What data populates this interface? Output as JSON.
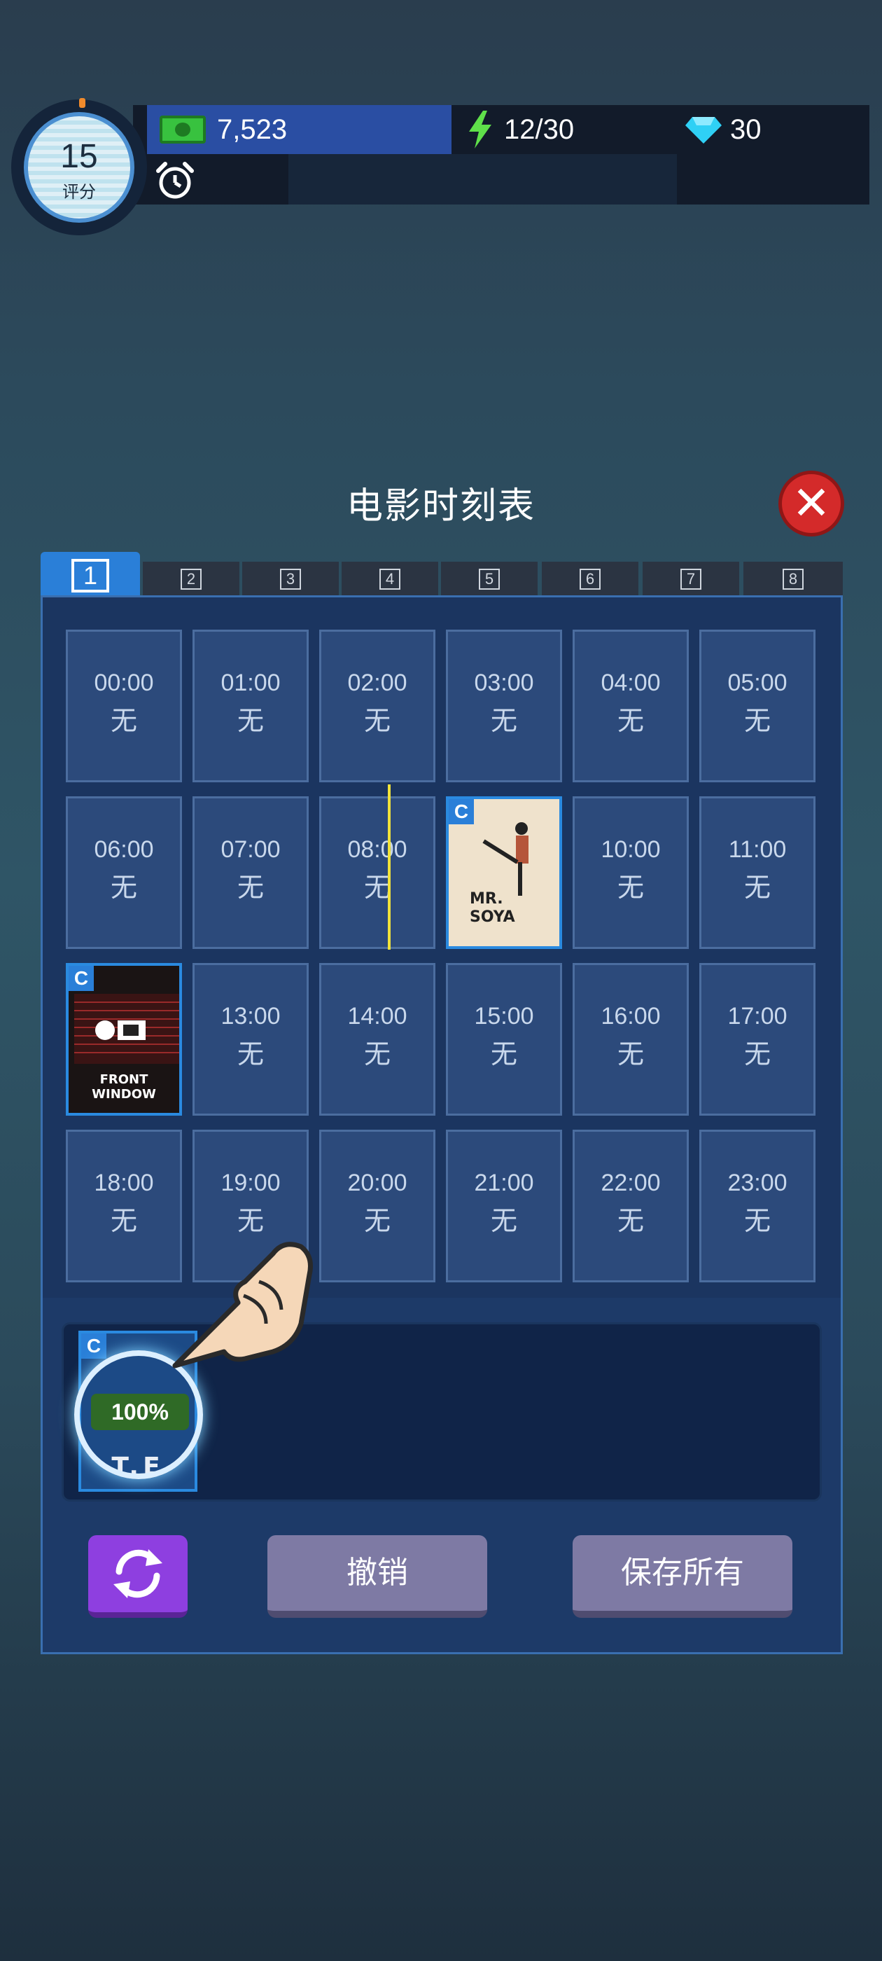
{
  "hud": {
    "score": "15",
    "score_label": "评分",
    "money": "7,523",
    "energy": "12/30",
    "gems": "30",
    "icons": [
      "cash-icon",
      "lightning-icon",
      "diamond-icon",
      "alarm-clock-icon"
    ]
  },
  "dialog": {
    "title": "电影时刻表",
    "close_icon": "close-icon"
  },
  "tabs": [
    {
      "label": "1",
      "active": true
    },
    {
      "label": "2"
    },
    {
      "label": "3"
    },
    {
      "label": "4"
    },
    {
      "label": "5"
    },
    {
      "label": "6"
    },
    {
      "label": "7"
    },
    {
      "label": "8"
    }
  ],
  "schedule": {
    "empty_label": "无",
    "slots": [
      {
        "time": "00:00",
        "status": "无"
      },
      {
        "time": "01:00",
        "status": "无"
      },
      {
        "time": "02:00",
        "status": "无"
      },
      {
        "time": "03:00",
        "status": "无"
      },
      {
        "time": "04:00",
        "status": "无"
      },
      {
        "time": "05:00",
        "status": "无"
      },
      {
        "time": "06:00",
        "status": "无"
      },
      {
        "time": "07:00",
        "status": "无"
      },
      {
        "time": "08:00",
        "status": "无"
      },
      {
        "time": "",
        "movie": {
          "grade": "C",
          "title": "MR.\nSOYA"
        }
      },
      {
        "time": "10:00",
        "status": "无"
      },
      {
        "time": "11:00",
        "status": "无"
      },
      {
        "time": "",
        "movie": {
          "grade": "C",
          "title": "FRONT WINDOW"
        }
      },
      {
        "time": "13:00",
        "status": "无"
      },
      {
        "time": "14:00",
        "status": "无"
      },
      {
        "time": "15:00",
        "status": "无"
      },
      {
        "time": "16:00",
        "status": "无"
      },
      {
        "time": "17:00",
        "status": "无"
      },
      {
        "time": "18:00",
        "status": "无"
      },
      {
        "time": "19:00",
        "status": "无"
      },
      {
        "time": "20:00",
        "status": "无"
      },
      {
        "time": "21:00",
        "status": "无"
      },
      {
        "time": "22:00",
        "status": "无"
      },
      {
        "time": "23:00",
        "status": "无"
      }
    ]
  },
  "tray": {
    "card": {
      "grade": "C",
      "title": "T.E",
      "progress": "100%"
    }
  },
  "buttons": {
    "refresh_icon": "refresh-icon",
    "undo": "撤销",
    "save_all": "保存所有"
  }
}
